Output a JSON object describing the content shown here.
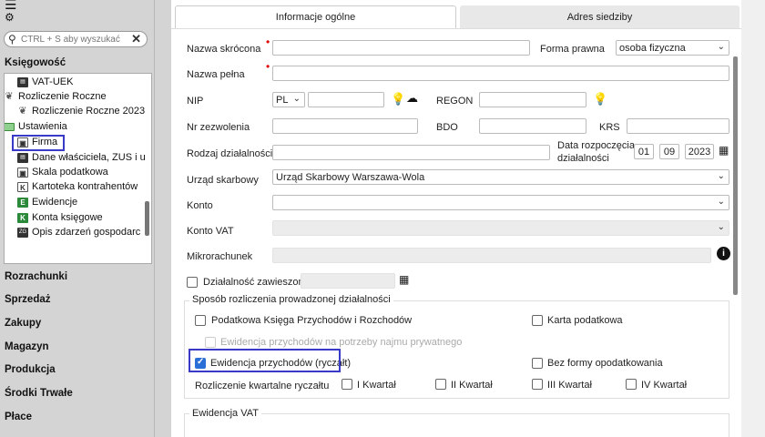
{
  "sidebar": {
    "search_placeholder": "CTRL + S aby wyszukać",
    "section_title": "Księgowość",
    "tree_items": [
      {
        "label": "VAT-UEK",
        "icon": "vat-icon"
      },
      {
        "label": "Rozliczenie Roczne",
        "icon": "wreath-icon"
      },
      {
        "label": "Rozliczenie Roczne 2023",
        "icon": "wreath-icon"
      },
      {
        "label": "Ustawienia",
        "icon": "folder-icon"
      },
      {
        "label": "Firma",
        "icon": "company-icon"
      },
      {
        "label": "Dane właściciela, ZUS i u",
        "icon": "owner-icon"
      },
      {
        "label": "Skala podatkowa",
        "icon": "scale-icon"
      },
      {
        "label": "Kartoteka kontrahentów",
        "icon": "contractor-icon"
      },
      {
        "label": "Ewidencje",
        "icon": "register-icon"
      },
      {
        "label": "Konta księgowe",
        "icon": "accounts-icon"
      },
      {
        "label": "Opis zdarzeń gospodarc",
        "icon": "events-icon"
      }
    ],
    "nav_items": [
      "Rozrachunki",
      "Sprzedaż",
      "Zakupy",
      "Magazyn",
      "Produkcja",
      "Środki Trwałe",
      "Płace"
    ]
  },
  "tabs": {
    "general": "Informacje ogólne",
    "seat": "Adres siedziby"
  },
  "form": {
    "short_name_label": "Nazwa skrócona",
    "legal_form_label": "Forma prawna",
    "legal_form_value": "osoba fizyczna",
    "full_name_label": "Nazwa pełna",
    "nip_label": "NIP",
    "nip_country": "PL",
    "regon_label": "REGON",
    "permit_label": "Nr zezwolenia",
    "bdo_label": "BDO",
    "krs_label": "KRS",
    "activity_label": "Rodzaj działalności",
    "start_date_label_1": "Data rozpoczęcia",
    "start_date_label_2": "działalności",
    "start_day": "01",
    "start_month": "09",
    "start_year": "2023",
    "tax_office_label": "Urząd skarbowy",
    "tax_office_value": "Urząd Skarbowy Warszawa-Wola",
    "account_label": "Konto",
    "vat_account_label": "Konto VAT",
    "microaccount_label": "Mikrorachunek",
    "suspended_label": "Działalność zawieszona",
    "settlement_group_title": "Sposób rozliczenia prowadzonej działalności",
    "pkpir_label": "Podatkowa Księga Przychodów i Rozchodów",
    "tax_card_label": "Karta podatkowa",
    "rental_label": "Ewidencja przychodów na potrzeby najmu prywatnego",
    "lump_sum_label": "Ewidencja przychodów (ryczałt)",
    "no_tax_label": "Bez formy opodatkowania",
    "quarterly_label": "Rozliczenie kwartalne ryczałtu",
    "q1": "I Kwartał",
    "q2": "II Kwartał",
    "q3": "III Kwartał",
    "q4": "IV Kwartał",
    "vat_group_title": "Ewidencja VAT"
  },
  "colors": {
    "highlight": "#3a3ac8",
    "checked": "#2b6fd6",
    "required": "#dd0000"
  }
}
